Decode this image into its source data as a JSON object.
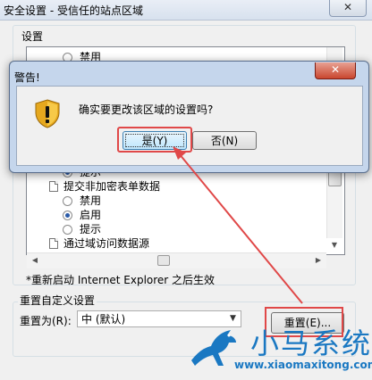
{
  "window": {
    "title": "安全设置 - 受信任的站点区域",
    "close_glyph": "✕"
  },
  "settings": {
    "group_label": "设置",
    "rows": [
      {
        "kind": "radio",
        "label": "禁用",
        "checked": false
      },
      {
        "kind": "radio",
        "label": "提示",
        "checked": true
      },
      {
        "kind": "category",
        "label": "提交非加密表单数据"
      },
      {
        "kind": "radio",
        "label": "禁用",
        "checked": false
      },
      {
        "kind": "radio",
        "label": "启用",
        "checked": true
      },
      {
        "kind": "radio",
        "label": "提示",
        "checked": false
      },
      {
        "kind": "category",
        "label": "通过域访问数据源"
      }
    ],
    "note": "*重新启动 Internet Explorer 之后生效"
  },
  "reset": {
    "group_label": "重置自定义设置",
    "label": "重置为(R):",
    "select_value": "中 (默认)",
    "button_label": "重置(E)..."
  },
  "warning": {
    "title": "警告!",
    "close_glyph": "✕",
    "message": "确实要更改该区域的设置吗?",
    "yes_label": "是(Y)",
    "no_label": "否(N)"
  },
  "watermark": {
    "brand": "小马系统",
    "url": "www.xiaomaxitong.com"
  },
  "colors": {
    "highlight_red": "#e04848",
    "watermark_blue": "#1a78c2"
  }
}
